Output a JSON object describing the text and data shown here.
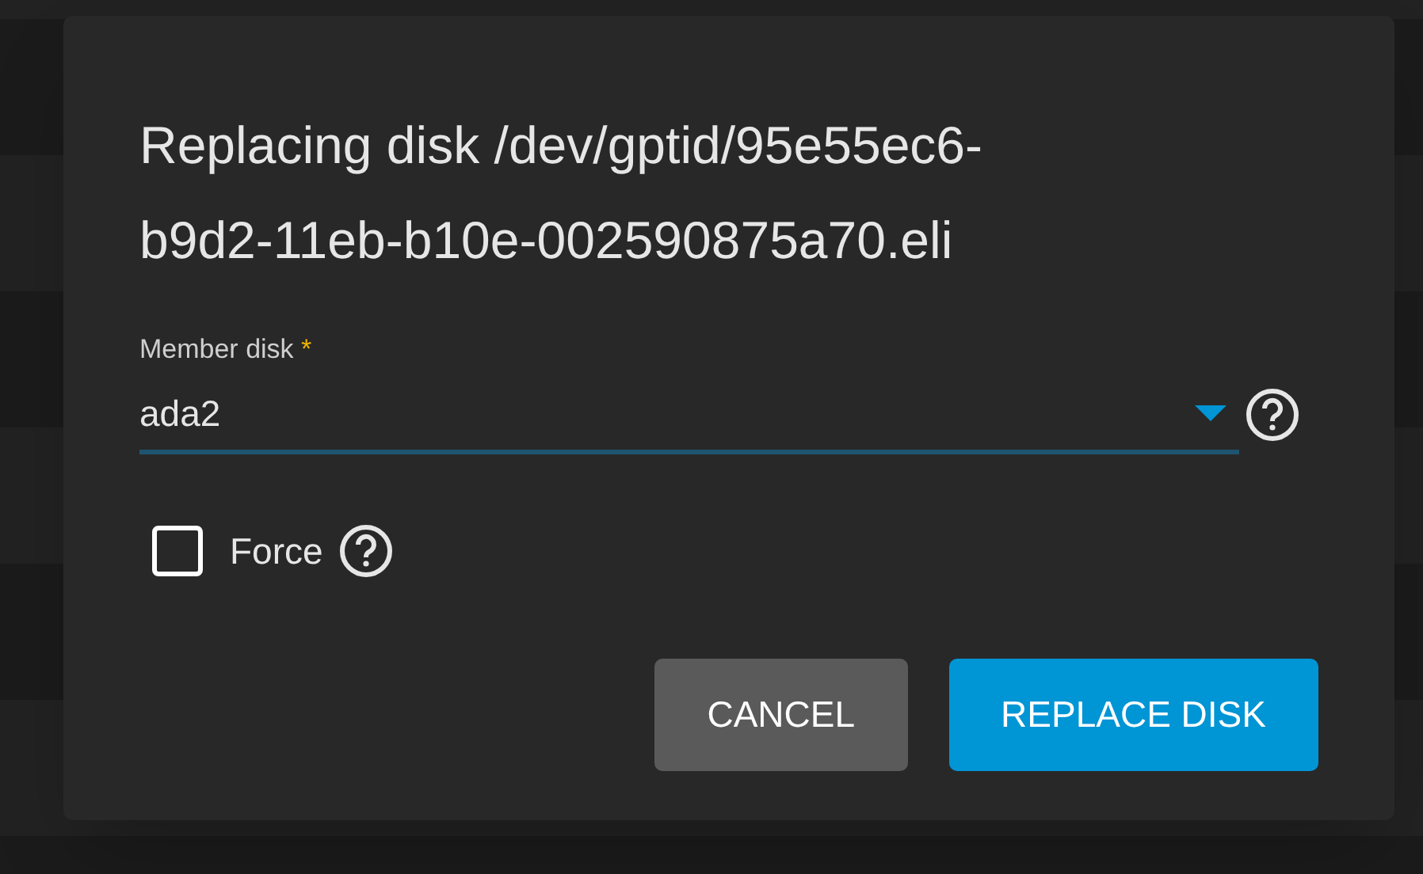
{
  "dialog": {
    "title": "Replacing disk /dev/gptid/95e55ec6-b9d2-11eb-b10e-002590875a70.eli",
    "member_disk": {
      "label": "Member disk",
      "required_mark": "*",
      "value": "ada2"
    },
    "force": {
      "label": "Force",
      "checked": false
    },
    "buttons": [
      {
        "label": "CANCEL",
        "kind": "secondary"
      },
      {
        "label": "REPLACE DISK",
        "kind": "primary"
      }
    ]
  }
}
